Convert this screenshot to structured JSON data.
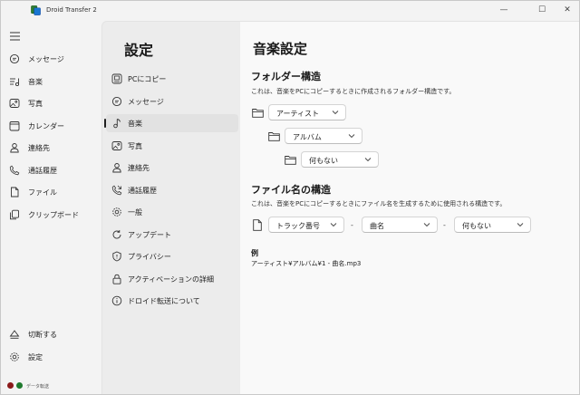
{
  "app": {
    "title": "Droid Transfer 2"
  },
  "window_controls": {
    "minimize": "—",
    "maximize": "☐",
    "close": "✕"
  },
  "nav": {
    "items": [
      {
        "label": "メッセージ",
        "icon": "message-icon"
      },
      {
        "label": "音楽",
        "icon": "music-icon"
      },
      {
        "label": "写真",
        "icon": "photo-icon"
      },
      {
        "label": "カレンダー",
        "icon": "calendar-icon"
      },
      {
        "label": "連絡先",
        "icon": "contact-icon"
      },
      {
        "label": "通話履歴",
        "icon": "phone-icon"
      },
      {
        "label": "ファイル",
        "icon": "file-icon"
      },
      {
        "label": "クリップボード",
        "icon": "clipboard-icon"
      }
    ],
    "disconnect_label": "切断する",
    "settings_label": "設定",
    "status_text": "データ転送",
    "status_colors": [
      "#8b1a1a",
      "#1f7a2e"
    ]
  },
  "settings": {
    "title": "設定",
    "items": [
      {
        "label": "PCにコピー",
        "icon": "pc-copy-icon"
      },
      {
        "label": "メッセージ",
        "icon": "message-icon"
      },
      {
        "label": "音楽",
        "icon": "music-icon",
        "active": true
      },
      {
        "label": "写真",
        "icon": "photo-icon"
      },
      {
        "label": "連絡先",
        "icon": "contact-icon"
      },
      {
        "label": "通話履歴",
        "icon": "phone-history-icon"
      },
      {
        "label": "一般",
        "icon": "gear-icon"
      },
      {
        "label": "アップデート",
        "icon": "update-icon"
      },
      {
        "label": "プライバシー",
        "icon": "shield-icon"
      },
      {
        "label": "アクティベーションの詳細",
        "icon": "lock-icon"
      },
      {
        "label": "ドロイド転送について",
        "icon": "info-icon"
      }
    ]
  },
  "content": {
    "title": "音楽設定",
    "folder_section": {
      "title": "フォルダー構造",
      "description": "これは、音楽をPCにコピーするときに作成されるフォルダー構造です。",
      "levels": [
        "アーティスト",
        "アルバム",
        "何もない"
      ]
    },
    "filename_section": {
      "title": "ファイル名の構造",
      "description": "これは、音楽をPCにコピーするときにファイル名を生成するために使用される構造です。",
      "parts": [
        "トラック番号",
        "曲名",
        "何もない"
      ],
      "separator": "-"
    },
    "example": {
      "label": "例",
      "value": "アーティスト¥アルバム¥1 - 曲名.mp3"
    }
  }
}
